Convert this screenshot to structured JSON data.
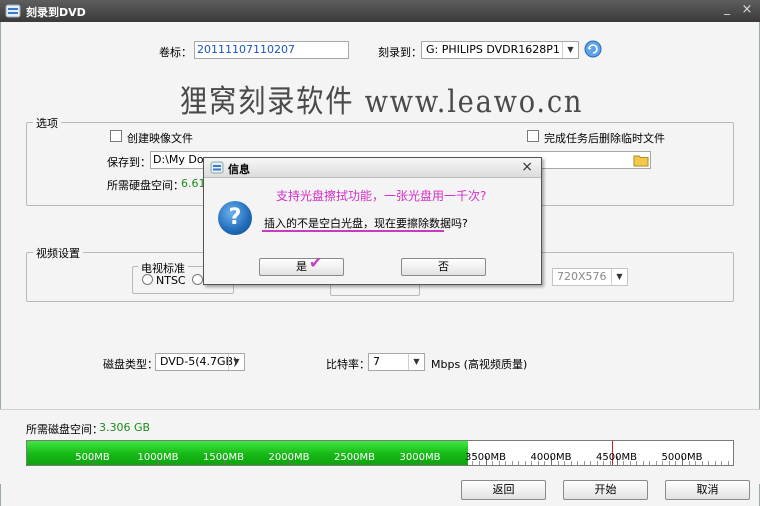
{
  "window": {
    "title": "刻录到DVD"
  },
  "header": {
    "volume_label": "卷标：",
    "volume_value": "20111107110207",
    "burn_to_label": "刻录到：",
    "burn_to_value": "G: PHILIPS  DVDR1628P1"
  },
  "watermark": "狸窝刻录软件 www.leawo.cn",
  "options": {
    "group_title": "选项",
    "create_image_label": "创建映像文件",
    "delete_temp_label": "完成任务后删除临时文件",
    "save_to_label": "保存到：",
    "save_to_value": "D:\\My Docu",
    "disk_space_label": "所需硬盘空间：",
    "disk_space_value": "6.61"
  },
  "video": {
    "group_title": "视频设置",
    "tv_standard_title": "电视标准",
    "ntsc_label": "NTSC",
    "resolution_value": "720X576"
  },
  "disc": {
    "disc_type_label": "磁盘类型：",
    "disc_type_value": "DVD-5(4.7GB)",
    "bitrate_label": "比特率：",
    "bitrate_value": "7",
    "bitrate_unit": "Mbps (高视频质量)"
  },
  "space": {
    "label": "所需磁盘空间：",
    "value": "3.306 GB",
    "fill_fraction": 0.624,
    "marker_fraction": 0.828,
    "ticks": [
      "500MB",
      "1000MB",
      "1500MB",
      "2000MB",
      "2500MB",
      "3000MB",
      "3500MB",
      "4000MB",
      "4500MB",
      "5000MB"
    ]
  },
  "buttons": {
    "back": "返回",
    "start": "开始",
    "cancel": "取消"
  },
  "dialog": {
    "title": "信息",
    "promo": "支持光盘擦拭功能，一张光盘用一千次?",
    "message": "插入的不是空白光盘，现在要擦除数据吗?",
    "yes": "是",
    "no": "否"
  },
  "colors": {
    "progress_fill": "#16b816",
    "accent_pink": "#d52fc8",
    "marker": "#c82020"
  },
  "icons": {
    "app": "dvd-app-icon",
    "refresh": "refresh-icon",
    "folder": "folder-icon",
    "question": "question-icon"
  }
}
